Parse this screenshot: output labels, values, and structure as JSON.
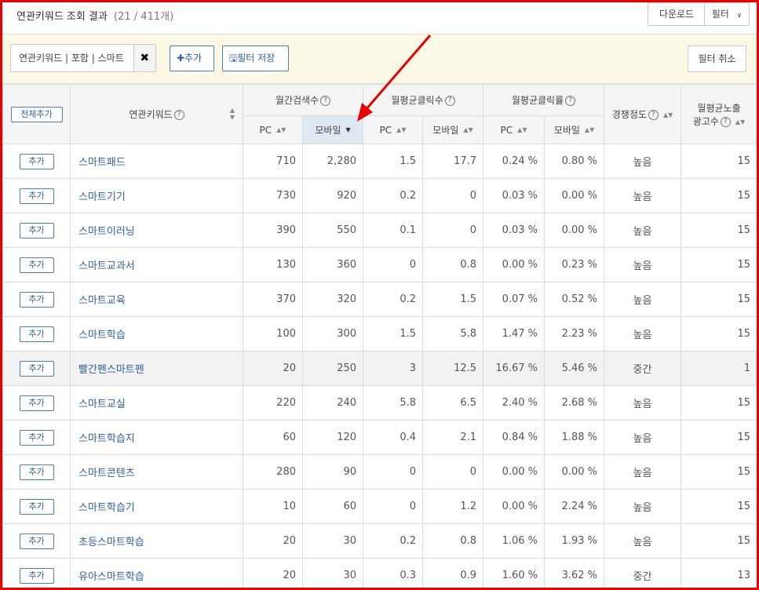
{
  "header": {
    "title": "연관키워드 조회 결과",
    "count": "(21 / 411개)",
    "download_label": "다운로드",
    "filter_label": "필터"
  },
  "filterbar": {
    "chip_label": "연관키워드 | 포함 | 스마트",
    "chip_close": "✖",
    "add_label": "✚추가",
    "save_label": "🖫필터 저장",
    "cancel_label": "필터 취소"
  },
  "table": {
    "add_all_label": "전체추가",
    "col_keyword": "연관키워드",
    "col_search": "월간검색수",
    "col_clicks": "월평균클릭수",
    "col_ctr": "월평균클릭률",
    "col_competition": "경쟁정도",
    "col_ads_line1": "월평균노출",
    "col_ads_line2": "광고수",
    "sub_pc": "PC",
    "sub_mobile": "모바일",
    "help_glyph": "?",
    "row_add_label": "추가",
    "rows": [
      {
        "keyword": "스마트패드",
        "pc_search": "710",
        "mo_search": "2,280",
        "pc_click": "1.5",
        "mo_click": "17.7",
        "pc_ctr": "0.24 %",
        "mo_ctr": "0.80 %",
        "comp": "높음",
        "ads": "15"
      },
      {
        "keyword": "스마트기기",
        "pc_search": "730",
        "mo_search": "920",
        "pc_click": "0.2",
        "mo_click": "0",
        "pc_ctr": "0.03 %",
        "mo_ctr": "0.00 %",
        "comp": "높음",
        "ads": "15"
      },
      {
        "keyword": "스마트이러닝",
        "pc_search": "390",
        "mo_search": "550",
        "pc_click": "0.1",
        "mo_click": "0",
        "pc_ctr": "0.03 %",
        "mo_ctr": "0.00 %",
        "comp": "높음",
        "ads": "15"
      },
      {
        "keyword": "스마트교과서",
        "pc_search": "130",
        "mo_search": "360",
        "pc_click": "0",
        "mo_click": "0.8",
        "pc_ctr": "0.00 %",
        "mo_ctr": "0.23 %",
        "comp": "높음",
        "ads": "15"
      },
      {
        "keyword": "스마트교육",
        "pc_search": "370",
        "mo_search": "320",
        "pc_click": "0.2",
        "mo_click": "1.5",
        "pc_ctr": "0.07 %",
        "mo_ctr": "0.52 %",
        "comp": "높음",
        "ads": "15"
      },
      {
        "keyword": "스마트학습",
        "pc_search": "100",
        "mo_search": "300",
        "pc_click": "1.5",
        "mo_click": "5.8",
        "pc_ctr": "1.47 %",
        "mo_ctr": "2.23 %",
        "comp": "높음",
        "ads": "15"
      },
      {
        "keyword": "빨간펜스마트펜",
        "pc_search": "20",
        "mo_search": "250",
        "pc_click": "3",
        "mo_click": "12.5",
        "pc_ctr": "16.67 %",
        "mo_ctr": "5.46 %",
        "comp": "중간",
        "ads": "1"
      },
      {
        "keyword": "스마트교실",
        "pc_search": "220",
        "mo_search": "240",
        "pc_click": "5.8",
        "mo_click": "6.5",
        "pc_ctr": "2.40 %",
        "mo_ctr": "2.68 %",
        "comp": "높음",
        "ads": "15"
      },
      {
        "keyword": "스마트학습지",
        "pc_search": "60",
        "mo_search": "120",
        "pc_click": "0.4",
        "mo_click": "2.1",
        "pc_ctr": "0.84 %",
        "mo_ctr": "1.88 %",
        "comp": "높음",
        "ads": "15"
      },
      {
        "keyword": "스마트콘텐츠",
        "pc_search": "280",
        "mo_search": "90",
        "pc_click": "0",
        "mo_click": "0",
        "pc_ctr": "0.00 %",
        "mo_ctr": "0.00 %",
        "comp": "높음",
        "ads": "15"
      },
      {
        "keyword": "스마트학습기",
        "pc_search": "10",
        "mo_search": "60",
        "pc_click": "0",
        "mo_click": "1.2",
        "pc_ctr": "0.00 %",
        "mo_ctr": "2.24 %",
        "comp": "높음",
        "ads": "15"
      },
      {
        "keyword": "초등스마트학습",
        "pc_search": "20",
        "mo_search": "30",
        "pc_click": "0.2",
        "mo_click": "0.8",
        "pc_ctr": "1.06 %",
        "mo_ctr": "1.93 %",
        "comp": "높음",
        "ads": "15"
      },
      {
        "keyword": "유아스마트학습",
        "pc_search": "20",
        "mo_search": "30",
        "pc_click": "0.3",
        "mo_click": "0.9",
        "pc_ctr": "1.60 %",
        "mo_ctr": "3.62 %",
        "comp": "중간",
        "ads": "13"
      }
    ]
  },
  "colors": {
    "frame_border": "#e60000",
    "annotation_arrow": "#e60000",
    "link_blue": "#2e5fa8",
    "filter_bar_bg": "#fbf8e5",
    "sorted_header_bg": "#dfe9f4",
    "highlight_row_bg": "#f2f2f2"
  },
  "icons": {
    "help": "question-circle-icon",
    "sort": "sort-updown-icon",
    "sort_active": "sort-desc-icon",
    "dropdown": "chevron-down-icon",
    "close": "close-icon",
    "plus": "plus-icon",
    "save": "save-icon"
  }
}
